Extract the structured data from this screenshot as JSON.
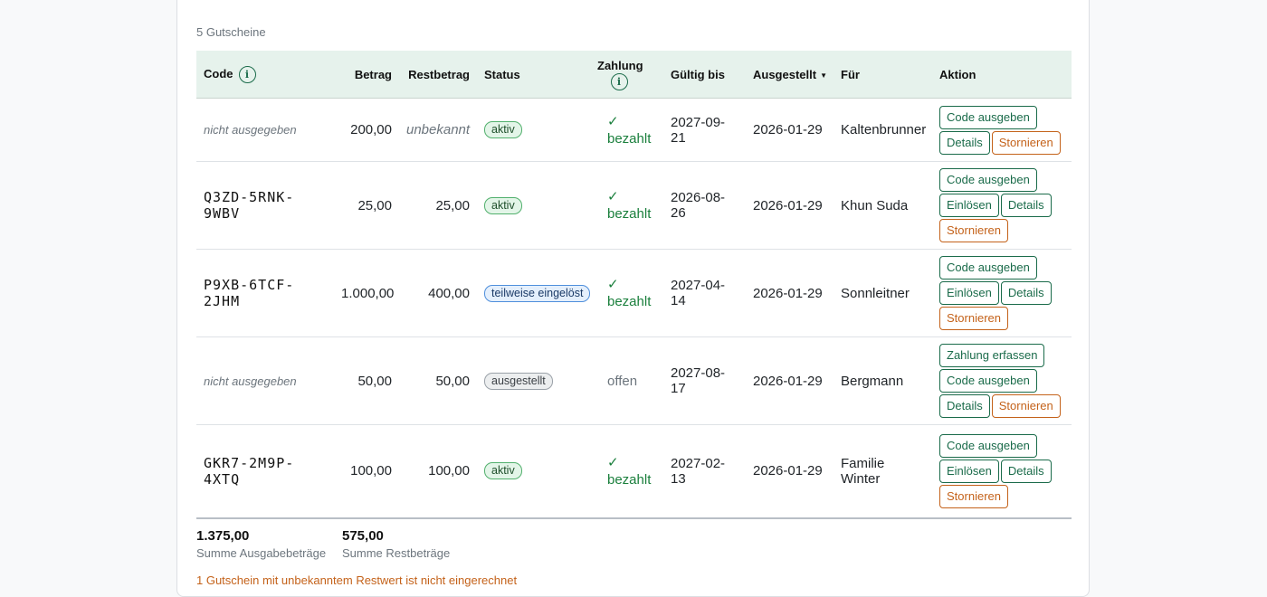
{
  "summary": {
    "count_label": "5 Gutscheine"
  },
  "table": {
    "headers": {
      "code": "Code",
      "betrag": "Betrag",
      "restbetrag": "Restbetrag",
      "status": "Status",
      "zahlung": "Zahlung",
      "gueltig": "Gültig bis",
      "ausgestellt": "Ausgestellt",
      "fuer": "Für",
      "aktion": "Aktion"
    },
    "sort_indicator": "▼",
    "rows": [
      {
        "code": "nicht ausgegeben",
        "code_issued": false,
        "betrag": "200,00",
        "restbetrag": "unbekannt",
        "rest_unknown": true,
        "status": "aktiv",
        "status_kind": "aktiv",
        "zahlung_check": "✓",
        "zahlung": "bezahlt",
        "paid": true,
        "gueltig": "2027-09-21",
        "ausgestellt": "2026-01-29",
        "fuer": "Kaltenbrunner",
        "actions": [
          {
            "label": "Code ausgeben",
            "style": "green"
          },
          {
            "label": "Details",
            "style": "green"
          },
          {
            "label": "Stornieren",
            "style": "orange"
          }
        ]
      },
      {
        "code": "Q3ZD-5RNK-9WBV",
        "code_issued": true,
        "betrag": "25,00",
        "restbetrag": "25,00",
        "rest_unknown": false,
        "status": "aktiv",
        "status_kind": "aktiv",
        "zahlung_check": "✓",
        "zahlung": "bezahlt",
        "paid": true,
        "gueltig": "2026-08-26",
        "ausgestellt": "2026-01-29",
        "fuer": "Khun Suda",
        "actions": [
          {
            "label": "Code ausgeben",
            "style": "green"
          },
          {
            "label": "Einlösen",
            "style": "green"
          },
          {
            "label": "Details",
            "style": "green"
          },
          {
            "label": "Stornieren",
            "style": "orange"
          }
        ]
      },
      {
        "code": "P9XB-6TCF-2JHM",
        "code_issued": true,
        "betrag": "1.000,00",
        "restbetrag": "400,00",
        "rest_unknown": false,
        "status": "teilweise eingelöst",
        "status_kind": "teil",
        "zahlung_check": "✓",
        "zahlung": "bezahlt",
        "paid": true,
        "gueltig": "2027-04-14",
        "ausgestellt": "2026-01-29",
        "fuer": "Sonnleitner",
        "actions": [
          {
            "label": "Code ausgeben",
            "style": "green"
          },
          {
            "label": "Einlösen",
            "style": "green"
          },
          {
            "label": "Details",
            "style": "green"
          },
          {
            "label": "Stornieren",
            "style": "orange"
          }
        ]
      },
      {
        "code": "nicht ausgegeben",
        "code_issued": false,
        "betrag": "50,00",
        "restbetrag": "50,00",
        "rest_unknown": false,
        "status": "ausgestellt",
        "status_kind": "aus",
        "zahlung_check": "",
        "zahlung": "offen",
        "paid": false,
        "gueltig": "2027-08-17",
        "ausgestellt": "2026-01-29",
        "fuer": "Bergmann",
        "actions": [
          {
            "label": "Zahlung erfassen",
            "style": "green"
          },
          {
            "label": "Code ausgeben",
            "style": "green"
          },
          {
            "label": "Details",
            "style": "green"
          },
          {
            "label": "Stornieren",
            "style": "orange"
          }
        ]
      },
      {
        "code": "GKR7-2M9P-4XTQ",
        "code_issued": true,
        "betrag": "100,00",
        "restbetrag": "100,00",
        "rest_unknown": false,
        "status": "aktiv",
        "status_kind": "aktiv",
        "zahlung_check": "✓",
        "zahlung": "bezahlt",
        "paid": true,
        "gueltig": "2027-02-13",
        "ausgestellt": "2026-01-29",
        "fuer": "Familie Winter",
        "actions": [
          {
            "label": "Code ausgeben",
            "style": "green"
          },
          {
            "label": "Einlösen",
            "style": "green"
          },
          {
            "label": "Details",
            "style": "green"
          },
          {
            "label": "Stornieren",
            "style": "orange"
          }
        ]
      }
    ]
  },
  "totals": {
    "ausgabe_value": "1.375,00",
    "ausgabe_label": "Summe Ausgabebeträge",
    "rest_value": "575,00",
    "rest_label": "Summe Restbeträge"
  },
  "warning": "1 Gutschein mit unbekanntem Restwert ist nicht eingerechnet",
  "colors": {
    "accent": "#1a6b4a",
    "danger": "#c4621a",
    "paid": "#1a7f3c",
    "header_bg": "#e6f2ec"
  }
}
